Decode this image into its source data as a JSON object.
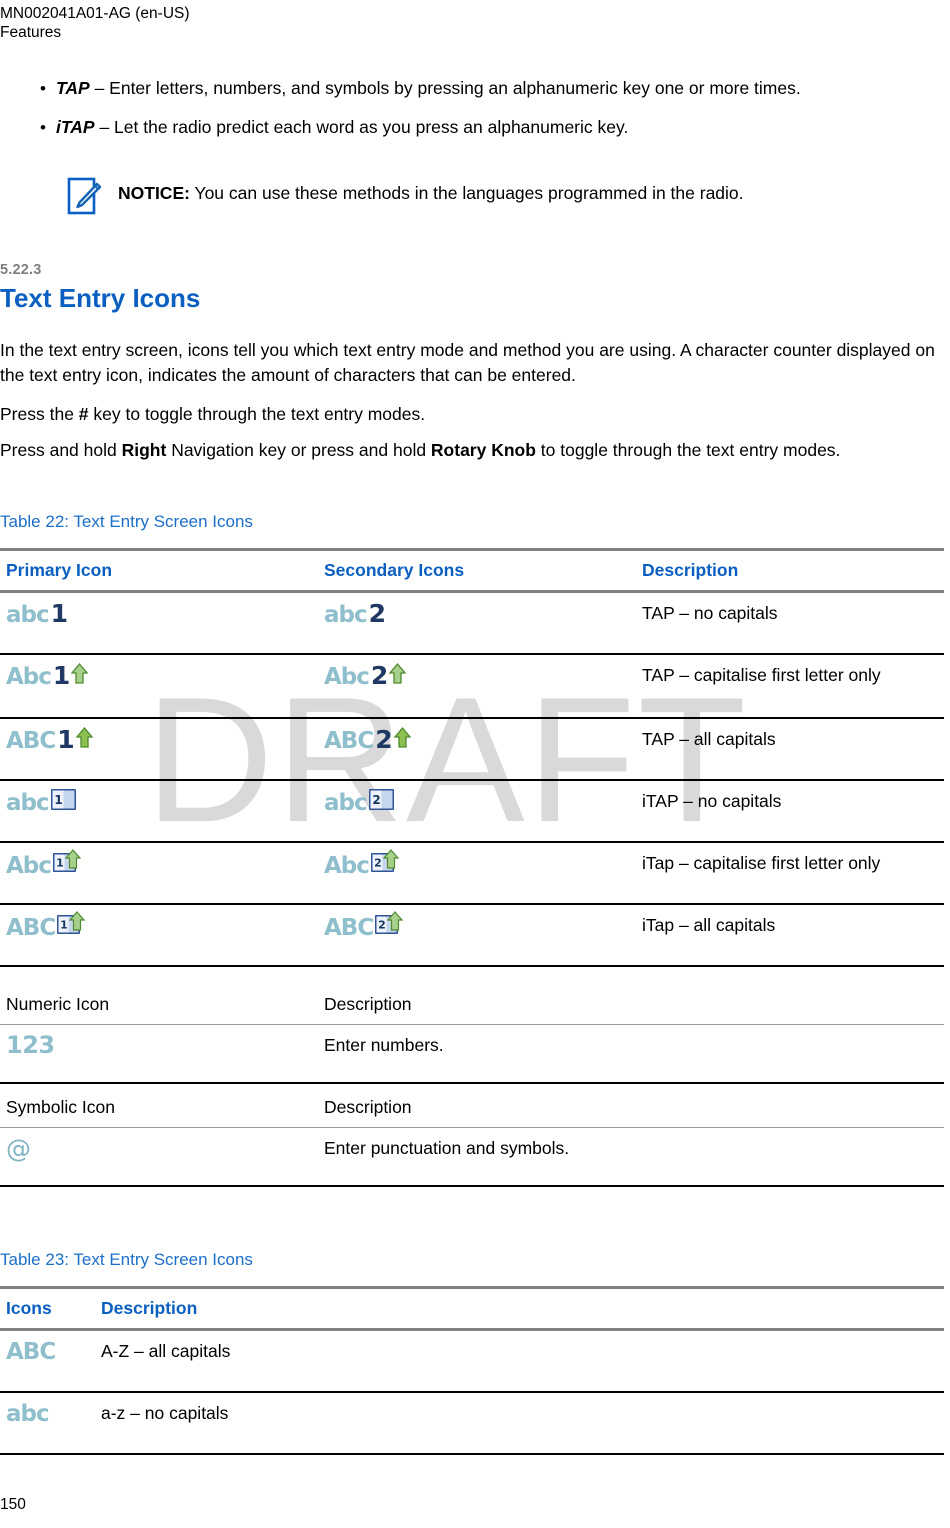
{
  "header": {
    "doc_id": "MN002041A01-AG (en-US)",
    "chapter": "Features"
  },
  "watermark": "DRAFT",
  "bullets": [
    {
      "marker": "•",
      "term": "TAP",
      "rest": " – Enter letters, numbers, and symbols by pressing an alphanumeric key one or more times."
    },
    {
      "marker": "•",
      "term": "iTAP",
      "rest": " – Let the radio predict each word as you press an alphanumeric key."
    }
  ],
  "notice": {
    "icon": "notice-pencil-icon",
    "label": "NOTICE:",
    "text": " You can use these methods in the languages programmed in the radio."
  },
  "section": {
    "number": "5.22.3",
    "title": "Text Entry Icons"
  },
  "paragraphs": {
    "p1": "In the text entry screen, icons tell you which text entry mode and method you are using. A character counter displayed on the text entry icon, indicates the amount of characters that can be entered.",
    "p2_pre": "Press the ",
    "p2_bold": "#",
    "p2_post": " key to toggle through the text entry modes.",
    "p3_pre": "Press and hold ",
    "p3_bold1": "Right",
    "p3_mid": " Navigation key or press and hold ",
    "p3_bold2": "Rotary Knob",
    "p3_post": " to toggle through the text entry modes."
  },
  "table22": {
    "caption": "Table 22: Text Entry Screen Icons",
    "columns": [
      "Primary Icon",
      "Secondary Icons",
      "Description"
    ],
    "rows": [
      {
        "primary_letters": "abc",
        "primary_num": "1",
        "primary_arrow": false,
        "primary_book": false,
        "secondary_letters": "abc",
        "secondary_num": "2",
        "secondary_arrow": false,
        "secondary_book": false,
        "description": "TAP – no capitals"
      },
      {
        "primary_letters": "Abc",
        "primary_num": "1",
        "primary_arrow": true,
        "primary_book": false,
        "secondary_letters": "Abc",
        "secondary_num": "2",
        "secondary_arrow": true,
        "secondary_book": false,
        "description": "TAP – capitalise first letter only"
      },
      {
        "primary_letters": "ABC",
        "primary_num": "1",
        "primary_arrow": true,
        "primary_book": false,
        "secondary_letters": "ABC",
        "secondary_num": "2",
        "secondary_arrow": true,
        "secondary_book": false,
        "description": "TAP – all capitals"
      },
      {
        "primary_letters": "abc",
        "primary_num": "1",
        "primary_arrow": false,
        "primary_book": true,
        "secondary_letters": "abc",
        "secondary_num": "2",
        "secondary_arrow": false,
        "secondary_book": true,
        "description": "iTAP – no capitals"
      },
      {
        "primary_letters": "Abc",
        "primary_num": "1",
        "primary_arrow": true,
        "primary_book": true,
        "secondary_letters": "Abc",
        "secondary_num": "2",
        "secondary_arrow": true,
        "secondary_book": true,
        "description": "iTap – capitalise first letter only"
      },
      {
        "primary_letters": "ABC",
        "primary_num": "1",
        "primary_arrow": true,
        "primary_book": true,
        "secondary_letters": "ABC",
        "secondary_num": "2",
        "secondary_arrow": true,
        "secondary_book": true,
        "description": "iTap – all capitals"
      }
    ],
    "numeric": {
      "columns": [
        "Numeric Icon",
        "Description"
      ],
      "icon_text": "123",
      "description": "Enter numbers."
    },
    "symbolic": {
      "columns": [
        "Symbolic Icon",
        "Description"
      ],
      "icon_text": "@",
      "description": "Enter punctuation and symbols."
    }
  },
  "table23": {
    "caption": "Table 23: Text Entry Screen Icons",
    "columns": [
      "Icons",
      "Description"
    ],
    "rows": [
      {
        "icon_text": "ABC",
        "description": "A-Z – all capitals"
      },
      {
        "icon_text": "abc",
        "description": "a-z – no capitals"
      }
    ]
  },
  "page_number": "150",
  "colors": {
    "heading_blue": "#0B5FC1",
    "caption_blue": "#1B6FC9",
    "section_number_gray": "#808080",
    "icon_teal": "#8FBFCC",
    "icon_navy": "#1F3864",
    "arrow_green": "#6FA83C",
    "watermark_gray": "#D9D9D9",
    "notice_blue": "#0B5FC1"
  }
}
